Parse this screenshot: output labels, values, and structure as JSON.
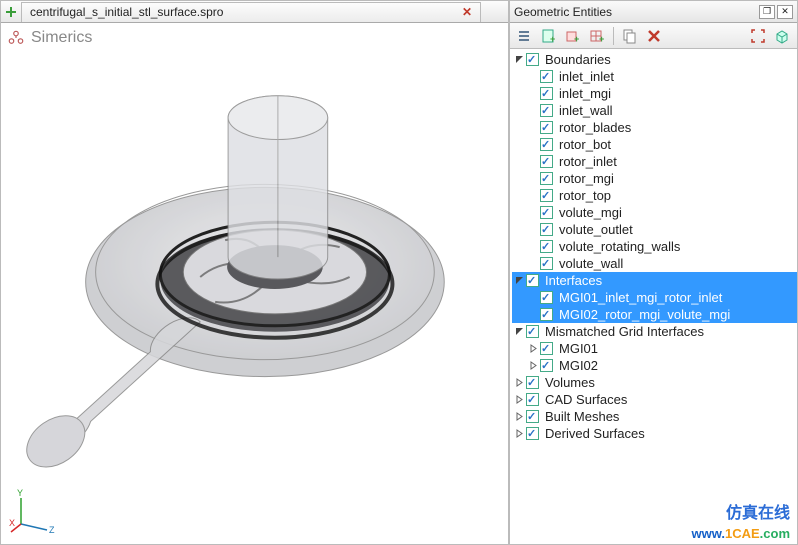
{
  "tab": {
    "name": "centrifugal_s_initial_stl_surface.spro"
  },
  "brand": "Simerics",
  "panel": {
    "title": "Geometric Entities"
  },
  "tree": {
    "boundaries": {
      "label": "Boundaries",
      "items": [
        "inlet_inlet",
        "inlet_mgi",
        "inlet_wall",
        "rotor_blades",
        "rotor_bot",
        "rotor_inlet",
        "rotor_mgi",
        "rotor_top",
        "volute_mgi",
        "volute_outlet",
        "volute_rotating_walls",
        "volute_wall"
      ]
    },
    "interfaces": {
      "label": "Interfaces",
      "items": [
        "MGI01_inlet_mgi_rotor_inlet",
        "MGI02_rotor_mgi_volute_mgi"
      ]
    },
    "mgi": {
      "label": "Mismatched Grid Interfaces",
      "items": [
        "MGI01",
        "MGI02"
      ]
    },
    "volumes": {
      "label": "Volumes"
    },
    "cad": {
      "label": "CAD Surfaces"
    },
    "built": {
      "label": "Built Meshes"
    },
    "derived": {
      "label": "Derived Surfaces"
    }
  },
  "watermark": {
    "cn": "仿真在线",
    "url_pre": "www.",
    "url_mid": "1CAE",
    "url_suf": ".com"
  }
}
